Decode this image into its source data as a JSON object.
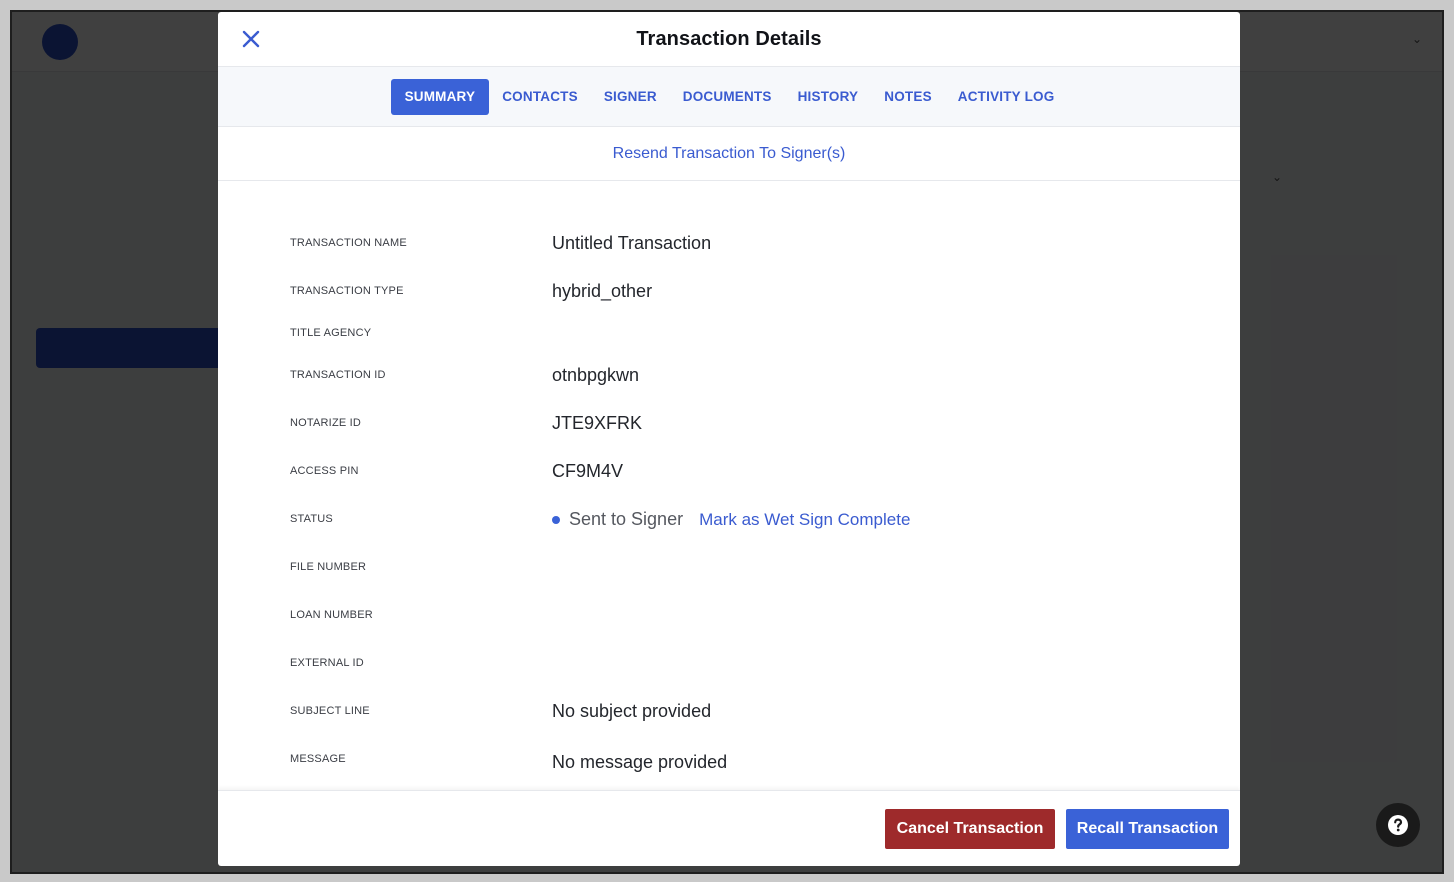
{
  "background": {
    "user_caret": "⌄",
    "sort_caret": "⌄"
  },
  "modal": {
    "title": "Transaction Details",
    "close_icon": "close-icon",
    "tabs": [
      {
        "label": "SUMMARY",
        "active": true
      },
      {
        "label": "CONTACTS",
        "active": false
      },
      {
        "label": "SIGNER",
        "active": false
      },
      {
        "label": "DOCUMENTS",
        "active": false
      },
      {
        "label": "HISTORY",
        "active": false
      },
      {
        "label": "NOTES",
        "active": false
      },
      {
        "label": "ACTIVITY LOG",
        "active": false
      }
    ],
    "resend_link": "Resend Transaction To Signer(s)",
    "details": {
      "transaction_name": {
        "label": "TRANSACTION NAME",
        "value": "Untitled Transaction"
      },
      "transaction_type": {
        "label": "TRANSACTION TYPE",
        "value": "hybrid_other"
      },
      "title_agency": {
        "label": "TITLE AGENCY",
        "value": ""
      },
      "transaction_id": {
        "label": "TRANSACTION ID",
        "value": "otnbpgkwn"
      },
      "notarize_id": {
        "label": "NOTARIZE ID",
        "value": "JTE9XFRK"
      },
      "access_pin": {
        "label": "ACCESS PIN",
        "value": "CF9M4V"
      },
      "status": {
        "label": "STATUS",
        "value": "Sent to Signer",
        "action": "Mark as Wet Sign Complete",
        "dot_color": "#3a62d7"
      },
      "file_number": {
        "label": "FILE NUMBER",
        "value": ""
      },
      "loan_number": {
        "label": "LOAN NUMBER",
        "value": ""
      },
      "external_id": {
        "label": "EXTERNAL ID",
        "value": ""
      },
      "subject_line": {
        "label": "SUBJECT LINE",
        "value": "No subject provided"
      },
      "message": {
        "label": "MESSAGE",
        "value": "No message provided"
      }
    },
    "footer": {
      "cancel_label": "Cancel Transaction",
      "recall_label": "Recall Transaction"
    }
  },
  "help_button": {
    "icon": "help-icon"
  },
  "colors": {
    "accent": "#3a62d7",
    "link": "#3a5bd0",
    "danger": "#9e2a2b",
    "overlay": "rgba(0,0,0,0.75)"
  }
}
